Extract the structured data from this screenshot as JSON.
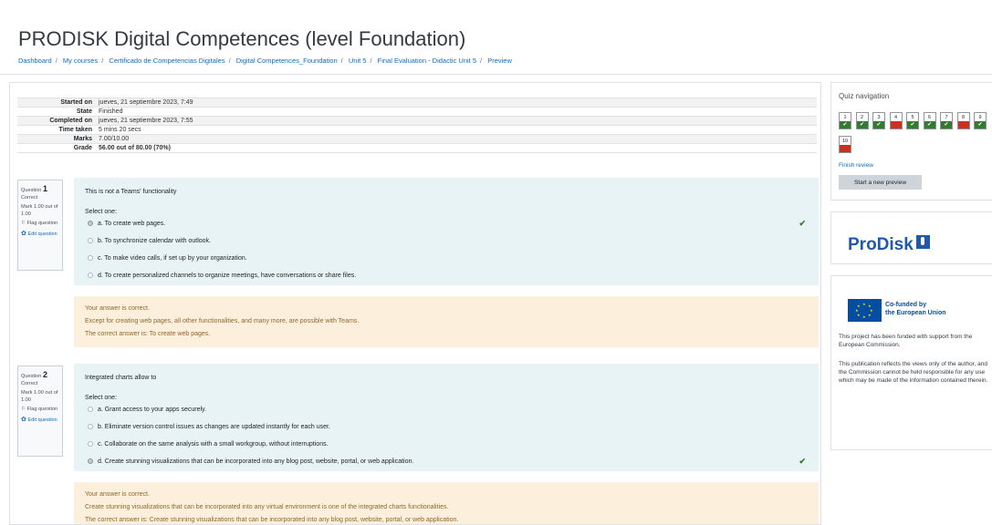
{
  "page": {
    "title": "PRODISK Digital Competences (level Foundation)"
  },
  "breadcrumb": [
    "Dashboard",
    "My courses",
    "Certificado de Competencias Digitales",
    "Digital Competences_Foundation",
    "Unit 5",
    "Final Evaluation - Didactic Unit 5",
    "Preview"
  ],
  "summary": [
    {
      "label": "Started on",
      "value": "jueves, 21 septiembre 2023, 7:49"
    },
    {
      "label": "State",
      "value": "Finished"
    },
    {
      "label": "Completed on",
      "value": "jueves, 21 septiembre 2023, 7:55"
    },
    {
      "label": "Time taken",
      "value": "5 mins 20 secs"
    },
    {
      "label": "Marks",
      "value": "7.00/10.00"
    },
    {
      "label": "Grade",
      "value": "56.00 out of 80.00 (70%)"
    }
  ],
  "questions": [
    {
      "label": "Question",
      "number": "1",
      "status": "Correct",
      "mark": "Mark 1.00 out of 1.00",
      "flag": "Flag question",
      "edit": "Edit question",
      "text": "This is not a Teams' functionality",
      "prompt": "Select one:",
      "options": [
        {
          "letter": "a.",
          "text": "To create web pages.",
          "selected": true
        },
        {
          "letter": "b.",
          "text": "To synchronize calendar with outlook.",
          "selected": false
        },
        {
          "letter": "c.",
          "text": "To make video calls, if set up by your organization.",
          "selected": false
        },
        {
          "letter": "d.",
          "text": "To create personalized channels to organize meetings, have conversations or share files.",
          "selected": false
        }
      ],
      "feedback": [
        "Your answer is correct.",
        "Except for creating web pages, all other functionalities, and many more, are possible with Teams.",
        "The correct answer is: To create web pages."
      ]
    },
    {
      "label": "Question",
      "number": "2",
      "status": "Correct",
      "mark": "Mark 1.00 out of 1.00",
      "flag": "Flag question",
      "edit": "Edit question",
      "text": "Integrated charts allow to",
      "prompt": "Select one:",
      "options": [
        {
          "letter": "a.",
          "text": "Grant access to your apps securely.",
          "selected": false
        },
        {
          "letter": "b.",
          "text": "Eliminate version control issues as changes are updated instantly for each user.",
          "selected": false
        },
        {
          "letter": "c.",
          "text": "Collaborate on the same analysis with a small workgroup, without interruptions.",
          "selected": false
        },
        {
          "letter": "d.",
          "text": "Create stunning visualizations that can be incorporated into any blog post, website, portal, or web application.",
          "selected": true
        }
      ],
      "feedback": [
        "Your answer is correct.",
        "Create stunning visualizations that can be incorporated into any virtual environment is one of the integrated charts functionalities.",
        "The correct answer is: Create stunning visualizations that can be incorporated into any blog post, website, portal, or web application."
      ]
    }
  ],
  "quiz_nav": {
    "title": "Quiz navigation",
    "buttons": [
      {
        "num": "1",
        "state": "correct"
      },
      {
        "num": "2",
        "state": "correct"
      },
      {
        "num": "3",
        "state": "correct"
      },
      {
        "num": "4",
        "state": "incorrect"
      },
      {
        "num": "5",
        "state": "correct"
      },
      {
        "num": "6",
        "state": "correct"
      },
      {
        "num": "7",
        "state": "correct"
      },
      {
        "num": "8",
        "state": "incorrect"
      },
      {
        "num": "9",
        "state": "correct"
      },
      {
        "num": "10",
        "state": "incorrect"
      }
    ],
    "finish_review": "Finish review",
    "start_new_preview": "Start a new preview"
  },
  "icons": {
    "correct": "✔",
    "flag": "⚐",
    "cog": "✿"
  },
  "branding": {
    "logo_text": "ProDisk",
    "color": "#1f5aa8"
  },
  "eu": {
    "line1": "Co-funded by",
    "line2": "the European Union",
    "p1": "This project has been funded with support from the European Commission.",
    "p2": "This publication reflects the views only of the author, and the Commission cannot be held responsible for any use which may be made of the information contained therein."
  }
}
